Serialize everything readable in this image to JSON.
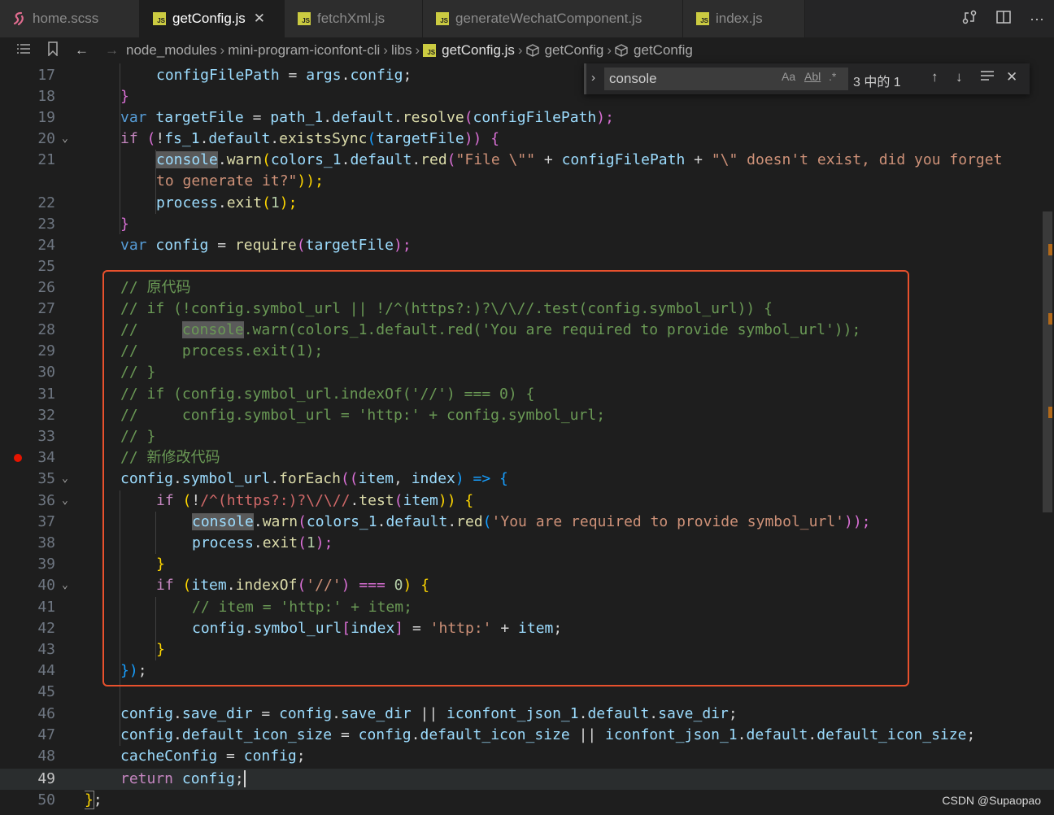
{
  "tabs": [
    {
      "label": "home.scss",
      "icon": "scss-file-icon"
    },
    {
      "label": "getConfig.js",
      "icon": "js-file-icon",
      "active": true
    },
    {
      "label": "fetchXml.js",
      "icon": "js-file-icon"
    },
    {
      "label": "generateWechatComponent.js",
      "icon": "js-file-icon"
    },
    {
      "label": "index.js",
      "icon": "js-file-icon"
    }
  ],
  "tab_badge": "JS",
  "breadcrumb": {
    "items": [
      "node_modules",
      "mini-program-iconfont-cli",
      "libs",
      "getConfig.js",
      "getConfig",
      "getConfig"
    ]
  },
  "find": {
    "query": "console",
    "match_case": "Aa",
    "whole_word": "Abl",
    "regex": ".*",
    "result": "3 中的 1"
  },
  "line_numbers": [
    "17",
    "18",
    "19",
    "20",
    "21",
    "",
    "22",
    "23",
    "24",
    "25",
    "26",
    "27",
    "28",
    "29",
    "30",
    "31",
    "32",
    "33",
    "34",
    "35",
    "36",
    "37",
    "38",
    "39",
    "40",
    "41",
    "42",
    "43",
    "44",
    "45",
    "46",
    "47",
    "48",
    "49",
    "50"
  ],
  "current_line": "49",
  "breakpoint_line": "34",
  "code": {
    "l17": [
      "configFilePath",
      " = ",
      "args",
      ".",
      "config",
      ";"
    ],
    "l19": [
      "var",
      " ",
      "targetFile",
      " = ",
      "path_1",
      ".",
      "default",
      ".",
      "resolve",
      "(",
      "configFilePath",
      ");"
    ],
    "l20": [
      "if",
      " (",
      "!",
      "fs_1",
      ".",
      "default",
      ".",
      "existsSync",
      "(",
      "targetFile",
      ")) {"
    ],
    "l21a": [
      "console",
      ".",
      "warn",
      "(",
      "colors_1",
      ".",
      "default",
      ".",
      "red",
      "(",
      "\"File \\\"\"",
      " + ",
      "configFilePath",
      " + ",
      "\"\\\" doesn't exist, did you forget"
    ],
    "l21b": [
      "to generate it?\"",
      "));"
    ],
    "l22": [
      "process",
      ".",
      "exit",
      "(",
      "1",
      ");"
    ],
    "l23": [
      "}"
    ],
    "l24": [
      "var",
      " ",
      "config",
      " = ",
      "require",
      "(",
      "targetFile",
      ");"
    ],
    "l26": "// 原代码",
    "l27": "// if (!config.symbol_url || !/^(https?:)?\\/\\//.test(config.symbol_url)) {",
    "l28a": "//     ",
    "l28b": "console",
    "l28c": ".warn(colors_1.default.red('You are required to provide symbol_url'));",
    "l29": "//     process.exit(1);",
    "l30": "// }",
    "l31": "// if (config.symbol_url.indexOf('//') === 0) {",
    "l32": "//     config.symbol_url = 'http:' + config.symbol_url;",
    "l33": "// }",
    "l34": "// 新修改代码",
    "l35": [
      "config",
      ".",
      "symbol_url",
      ".",
      "forEach",
      "((",
      "item",
      ", ",
      "index",
      ") => {"
    ],
    "l36": [
      "if",
      " (",
      "!",
      "/^(https?:)?\\/\\//",
      ".",
      "test",
      "(",
      "item",
      ")) {"
    ],
    "l37": [
      "console",
      ".",
      "warn",
      "(",
      "colors_1",
      ".",
      "default",
      ".",
      "red",
      "(",
      "'You are required to provide symbol_url'",
      "));"
    ],
    "l38": [
      "process",
      ".",
      "exit",
      "(",
      "1",
      ");"
    ],
    "l39": [
      "}"
    ],
    "l40": [
      "if",
      " (",
      "item",
      ".",
      "indexOf",
      "(",
      "'//'",
      ") === ",
      "0",
      ") {"
    ],
    "l41": "// item = 'http:' + item;",
    "l42": [
      "config",
      ".",
      "symbol_url",
      "[",
      "index",
      "]",
      " = ",
      "'http:'",
      " + ",
      "item",
      ";"
    ],
    "l43": [
      "}"
    ],
    "l44": [
      "})",
      ";"
    ],
    "l46": [
      "config",
      ".",
      "save_dir",
      " = ",
      "config",
      ".",
      "save_dir",
      " || ",
      "iconfont_json_1",
      ".",
      "default",
      ".",
      "save_dir",
      ";"
    ],
    "l47": [
      "config",
      ".",
      "default_icon_size",
      " = ",
      "config",
      ".",
      "default_icon_size",
      " || ",
      "iconfont_json_1",
      ".",
      "default",
      ".",
      "default_icon_size",
      ";"
    ],
    "l48": [
      "cacheConfig",
      " = ",
      "config",
      ";"
    ],
    "l49": [
      "return",
      " ",
      "config",
      ";"
    ],
    "l50": [
      "}",
      ";"
    ]
  },
  "watermark": "CSDN @Supaopao",
  "colors": {
    "background": "#1e1e1e",
    "keyword": "#569cd6",
    "control": "#c586c0",
    "function": "#dcdcaa",
    "string": "#ce9178",
    "comment": "#6a9955",
    "number": "#b5cea8",
    "highlight_box": "#e8512d"
  }
}
